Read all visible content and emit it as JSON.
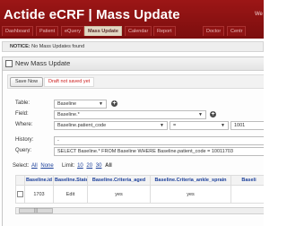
{
  "app": {
    "title": "Actide eCRF | Mass Update",
    "user": "We"
  },
  "tabs": [
    {
      "label": "Dashboard",
      "active": false
    },
    {
      "label": "Patient",
      "active": false
    },
    {
      "label": "eQuery",
      "active": false
    },
    {
      "label": "Mass Update",
      "active": true
    },
    {
      "label": "Calendar",
      "active": false
    },
    {
      "label": "Report",
      "active": false
    },
    {
      "label": "Doctor",
      "active": false
    },
    {
      "label": "Centr",
      "active": false
    }
  ],
  "notice": {
    "label": "NOTICE:",
    "text": "No Mass Updates found"
  },
  "dialog": {
    "title": "New Mass Update",
    "save_label": "Save Now",
    "draft_status": "Draft not saved yet"
  },
  "form": {
    "table_label": "Table:",
    "table_value": "Baseline",
    "field_label": "Field:",
    "field_value": "Baseline.*",
    "where_label": "Where:",
    "where_field": "Baseline.patient_code",
    "where_operator": "=",
    "where_value": "1001",
    "history_label": "History:",
    "history_value": "-",
    "query_label": "Query:",
    "query_value": "SELECT Baseline.* FROM Baseline WHERE Baseline.patient_code = 10011703"
  },
  "select_links": {
    "select_label": "Select:",
    "all": "All",
    "none": "None",
    "limit_label": "Limit:",
    "limits": [
      "10",
      "20",
      "30"
    ],
    "limit_all": "All"
  },
  "results": {
    "headers": [
      "Baseline.id",
      "Baseline.State",
      "Baseline.Criteria_aged",
      "Baseline.Criteria_ankle_sprain",
      "Baseli"
    ],
    "rows": [
      [
        "1703",
        "Edit",
        "yes",
        "yes",
        ""
      ]
    ]
  },
  "colors": {
    "header_bg": "#8e1313",
    "link": "#1b3f9a",
    "draft_text": "#cc1b1b"
  }
}
